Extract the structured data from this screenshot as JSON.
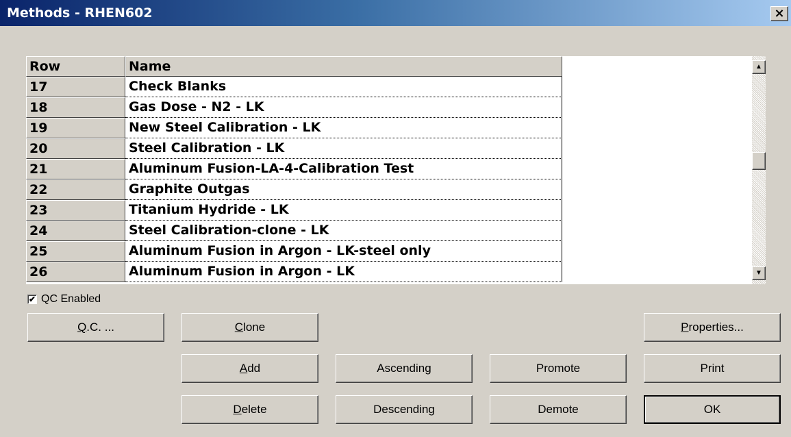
{
  "window": {
    "title": "Methods - RHEN602",
    "close_glyph": "×"
  },
  "grid": {
    "columns": [
      "Row",
      "Name"
    ],
    "rows": [
      {
        "row": "17",
        "name": "Check Blanks"
      },
      {
        "row": "18",
        "name": "Gas Dose - N2 - LK"
      },
      {
        "row": "19",
        "name": "New Steel Calibration - LK"
      },
      {
        "row": "20",
        "name": "Steel Calibration - LK"
      },
      {
        "row": "21",
        "name": "Aluminum Fusion-LA-4-Calibration Test"
      },
      {
        "row": "22",
        "name": "Graphite Outgas"
      },
      {
        "row": "23",
        "name": "Titanium Hydride - LK"
      },
      {
        "row": "24",
        "name": "Steel Calibration-clone - LK"
      },
      {
        "row": "25",
        "name": "Aluminum Fusion in Argon - LK-steel only"
      },
      {
        "row": "26",
        "name": "Aluminum Fusion in Argon - LK"
      }
    ]
  },
  "qc": {
    "label": "QC Enabled",
    "checked": true,
    "check_glyph": "✔"
  },
  "buttons": {
    "qc": {
      "mnemonic": "Q",
      "rest": ".C. ..."
    },
    "clone": {
      "mnemonic": "C",
      "rest": "lone"
    },
    "properties": {
      "mnemonic": "P",
      "rest": "roperties..."
    },
    "add": {
      "mnemonic": "A",
      "rest": "dd"
    },
    "ascending": {
      "label": "Ascending"
    },
    "promote": {
      "label": "Promote"
    },
    "print": {
      "label": "Print"
    },
    "delete": {
      "mnemonic": "D",
      "rest": "elete"
    },
    "descending": {
      "label": "Descending"
    },
    "demote": {
      "label": "Demote"
    },
    "ok": {
      "label": "OK"
    }
  },
  "scrollbar": {
    "up_glyph": "▲",
    "down_glyph": "▼"
  }
}
